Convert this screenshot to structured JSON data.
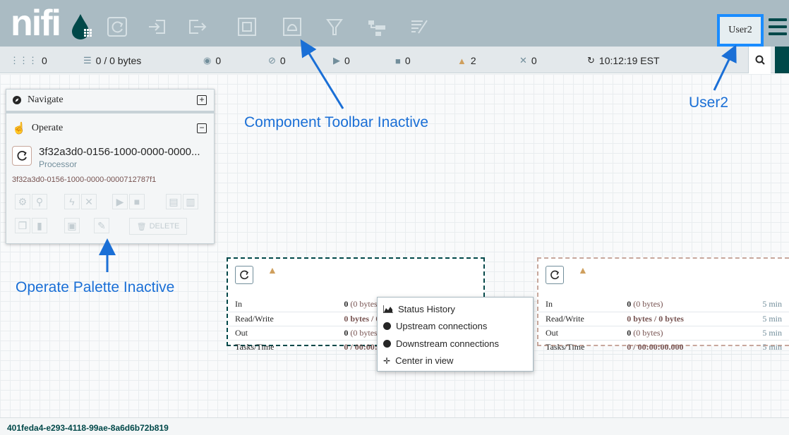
{
  "header": {
    "logo_text": "nifi",
    "user": "User2",
    "toolbar_icons": [
      "processor-icon",
      "input-port-icon",
      "output-port-icon",
      "process-group-icon",
      "remote-process-group-icon",
      "funnel-icon",
      "template-icon",
      "label-icon"
    ]
  },
  "status": {
    "transmitting": "0",
    "queued": "0 / 0 bytes",
    "transmitting_rpg": "0",
    "not_transmitting_rpg": "0",
    "running": "0",
    "stopped": "0",
    "invalid": "2",
    "disabled": "0",
    "refresh_time": "10:12:19 EST"
  },
  "palette": {
    "navigate_label": "Navigate",
    "operate_label": "Operate",
    "component_name": "3f32a3d0-0156-1000-0000-0000...",
    "component_type": "Processor",
    "component_id": "3f32a3d0-0156-1000-0000-0000712787f1",
    "delete_label": "DELETE"
  },
  "processor1": {
    "rows": [
      {
        "label": "In",
        "value": "0",
        "sub": "(0 bytes)"
      },
      {
        "label": "Read/Write",
        "value": "0 bytes / 0 bytes",
        "sub": ""
      },
      {
        "label": "Out",
        "value": "0",
        "sub": "(0 bytes)"
      },
      {
        "label": "Tasks/Time",
        "value": "0 / 00:00:00.000",
        "sub": ""
      }
    ]
  },
  "processor2": {
    "rows": [
      {
        "label": "In",
        "value": "0",
        "sub": "(0 bytes)",
        "time": "5 min"
      },
      {
        "label": "Read/Write",
        "value": "0 bytes / 0 bytes",
        "sub": "",
        "time": "5 min"
      },
      {
        "label": "Out",
        "value": "0",
        "sub": "(0 bytes)",
        "time": "5 min"
      },
      {
        "label": "Tasks/Time",
        "value": "0 / 00:00:00.000",
        "sub": "",
        "time": "5 min"
      }
    ]
  },
  "context_menu": {
    "items": [
      "Status History",
      "Upstream connections",
      "Downstream connections",
      "Center in view"
    ]
  },
  "footer": {
    "group_id": "401feda4-e293-4118-99ae-8a6d6b72b819"
  },
  "annotations": {
    "component_toolbar": "Component Toolbar Inactive",
    "user": "User2",
    "operate_palette": "Operate Palette Inactive"
  },
  "colors": {
    "header": "#aabbc3",
    "accent": "#004849",
    "annotation": "#1a6fd6",
    "warning": "#cf9f5d"
  }
}
